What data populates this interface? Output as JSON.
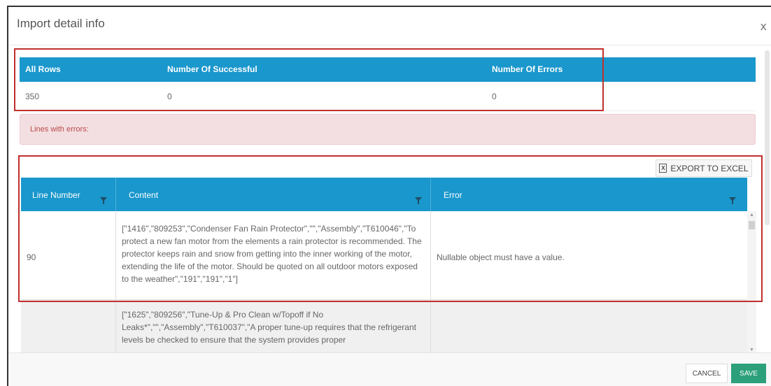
{
  "dialog": {
    "title": "Import detail info",
    "close_label": "x"
  },
  "summary": {
    "headers": [
      "All Rows",
      "Number Of Successful",
      "Number Of Errors"
    ],
    "values": [
      "350",
      "0",
      "0"
    ]
  },
  "errors_alert": "Lines with errors:",
  "export_button": "EXPORT TO EXCEL",
  "export_icon_label": "X",
  "grid": {
    "columns": [
      "Line Number",
      "Content",
      "Error"
    ],
    "rows": [
      {
        "line_number": "90",
        "content": "[\"1416\",\"809253\",\"Condenser Fan Rain Protector\",\"\",\"Assembly\",\"T610046\",\"To protect a new fan motor from the elements a rain protector is recommended. The protector keeps rain and snow from getting into the inner working of the motor, extending the life of the motor. Should be quoted on all outdoor motors exposed to the weather\",\"191\",\"191\",\"1\"]",
        "error": "Nullable object must have a value."
      },
      {
        "line_number": "",
        "content": "[\"1625\",\"809256\",\"Tune-Up & Pro Clean w/Topoff if No Leaks*\",\"\",\"Assembly\",\"T610037\",\"A proper tune-up requires that the refrigerant levels be checked to ensure that the system provides proper",
        "error": ""
      }
    ]
  },
  "footer": {
    "cancel": "CANCEL",
    "save": "SAVE"
  },
  "colors": {
    "header_blue": "#1a97cc",
    "save_green": "#2ca07a",
    "alert_bg": "#f3dfe1",
    "annotation_red": "#c0302e"
  }
}
